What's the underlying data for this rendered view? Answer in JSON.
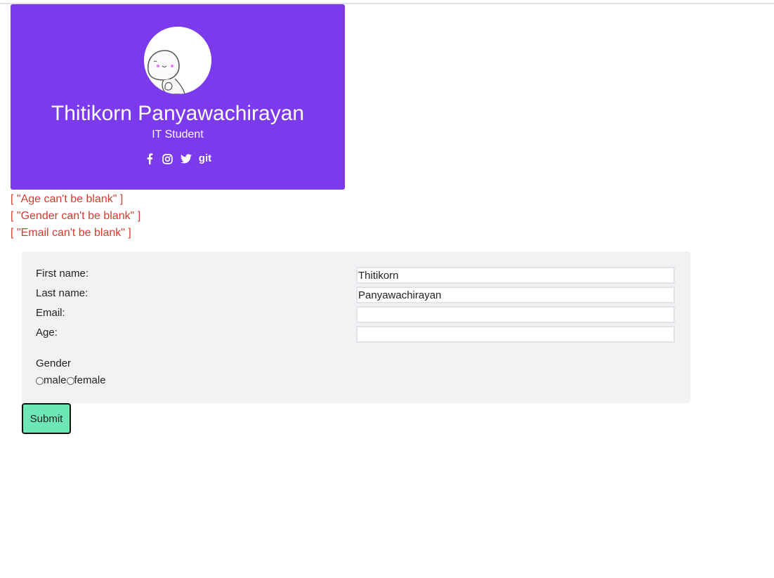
{
  "profile": {
    "name": "Thitikorn Panyawachirayan",
    "role": "IT Student",
    "social": [
      {
        "icon": "facebook-icon"
      },
      {
        "icon": "instagram-icon"
      },
      {
        "icon": "twitter-icon"
      },
      {
        "icon": "git-icon",
        "label": "git"
      }
    ],
    "colors": {
      "card_bg": "#7c3aed",
      "text": "#ffffff"
    }
  },
  "errors": [
    "[ \"Age can't be blank\" ]",
    "[ \"Gender can't be blank\" ]",
    "[ \"Email can't be blank\" ]"
  ],
  "form": {
    "first_name_label": "First name:",
    "first_name_value": "Thitikorn",
    "last_name_label": "Last name:",
    "last_name_value": "Panyawachirayan",
    "email_label": "Email:",
    "email_value": "",
    "age_label": "Age:",
    "age_value": "",
    "gender_label": "Gender",
    "gender_options": [
      "male",
      "female"
    ],
    "submit_label": "Submit"
  },
  "colors": {
    "error": "#d23b2e",
    "panel_bg": "#f1f2f4",
    "submit_bg": "#6ee7b7"
  }
}
